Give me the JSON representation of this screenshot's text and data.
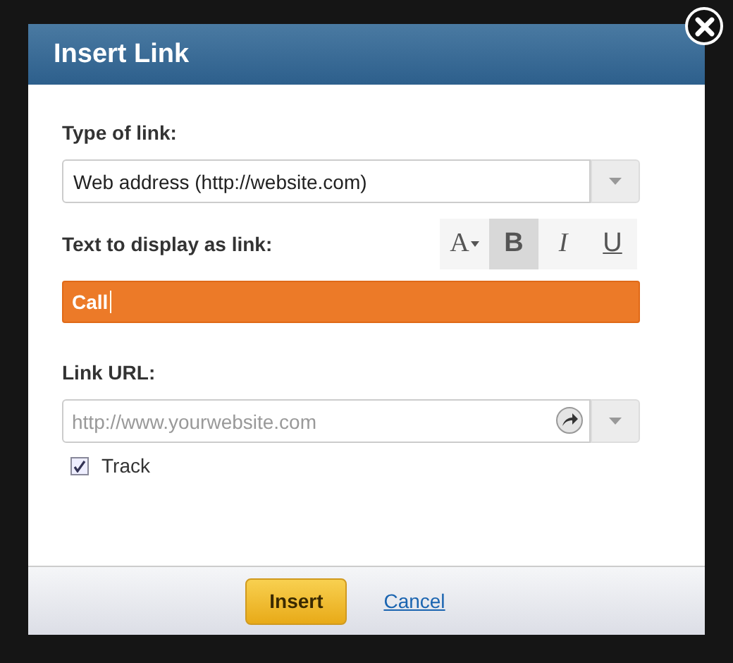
{
  "dialog": {
    "title": "Insert Link"
  },
  "type_field": {
    "label": "Type of link:",
    "value": "Web address (http://website.com)"
  },
  "display_field": {
    "label": "Text to display as link:",
    "value": "Call",
    "highlighted": true
  },
  "format_buttons": [
    {
      "kind": "color",
      "label": "A",
      "selected": false
    },
    {
      "kind": "bold",
      "label": "B",
      "selected": true
    },
    {
      "kind": "italic",
      "label": "I",
      "selected": false
    },
    {
      "kind": "underline",
      "label": "U",
      "selected": false
    }
  ],
  "url_field": {
    "label": "Link URL:",
    "placeholder": "http://www.yourwebsite.com"
  },
  "track": {
    "label": "Track",
    "checked": true
  },
  "buttons": {
    "primary": "Insert",
    "cancel": "Cancel"
  }
}
